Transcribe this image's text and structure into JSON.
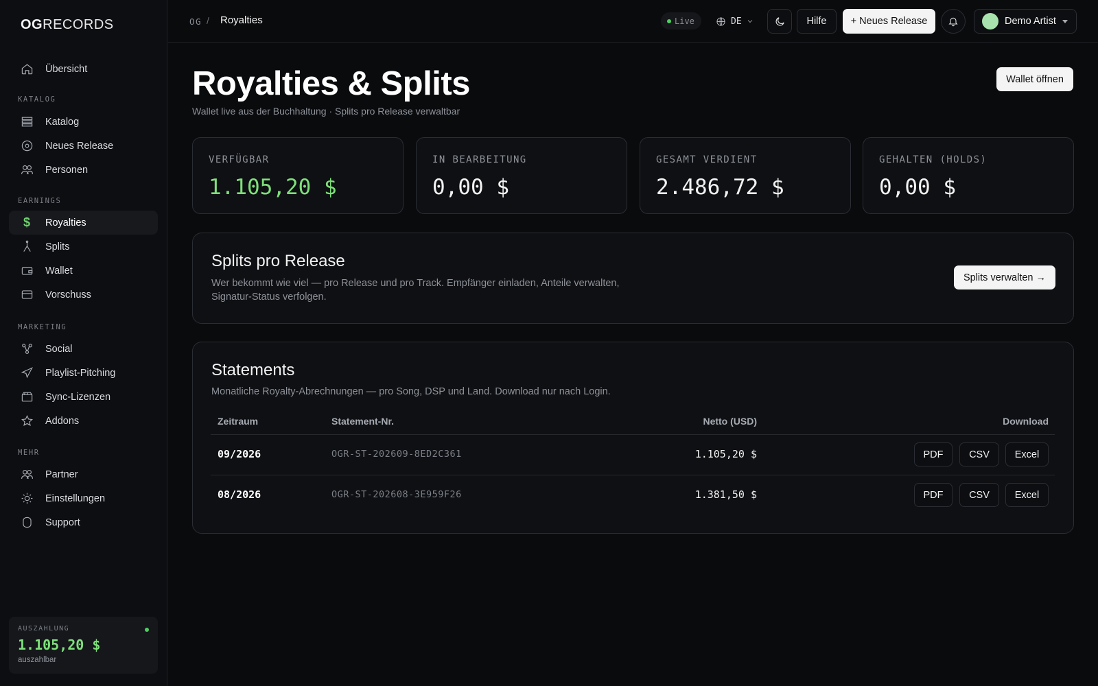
{
  "brand": {
    "logo_bold": "OG",
    "logo_rest": "RECORDS"
  },
  "sidebar": {
    "top_item": {
      "label": "Übersicht"
    },
    "sections": {
      "katalog": "KATALOG",
      "earnings": "EARNINGS",
      "marketing": "MARKETING",
      "mehr": "MEHR"
    },
    "items": {
      "katalog": "Katalog",
      "neues_release": "Neues Release",
      "personen": "Personen",
      "royalties": "Royalties",
      "splits": "Splits",
      "wallet": "Wallet",
      "vorschuss": "Vorschuss",
      "social": "Social",
      "playlist": "Playlist-Pitching",
      "sync": "Sync-Lizenzen",
      "addons": "Addons",
      "partner": "Partner",
      "einstellungen": "Einstellungen",
      "support": "Support"
    },
    "active": "Royalties",
    "payout": {
      "label": "AUSZAHLUNG",
      "amount": "1.105,20 $",
      "sub": "auszahlbar"
    }
  },
  "topbar": {
    "breadcrumb_root": "OG",
    "breadcrumb_sep": "/",
    "breadcrumb_current": "Royalties",
    "live_label": "Live",
    "language": "DE",
    "help_label": "Hilfe",
    "new_release_label": "+ Neues Release",
    "user_name": "Demo Artist"
  },
  "page": {
    "title": "Royalties & Splits",
    "subtitle": "Wallet live aus der Buchhaltung · Splits pro Release verwaltbar",
    "wallet_button": "Wallet öffnen"
  },
  "stats": [
    {
      "label": "VERFÜGBAR",
      "value": "1.105,20 $",
      "accent": true
    },
    {
      "label": "IN BEARBEITUNG",
      "value": "0,00 $",
      "accent": false
    },
    {
      "label": "GESAMT VERDIENT",
      "value": "2.486,72 $",
      "accent": false
    },
    {
      "label": "GEHALTEN (HOLDS)",
      "value": "0,00 $",
      "accent": false
    }
  ],
  "splits_card": {
    "title": "Splits pro Release",
    "desc_line1": "Wer bekommt wie viel — pro Release und pro Track. Empfänger einladen, Anteile verwalten,",
    "desc_line2": "Signatur-Status verfolgen.",
    "button": "Splits verwalten →"
  },
  "statements": {
    "title": "Statements",
    "desc": "Monatliche Royalty-Abrechnungen — pro Song, DSP und Land. Download nur nach Login.",
    "columns": [
      "Zeitraum",
      "Statement-Nr.",
      "Netto (USD)",
      "Download"
    ],
    "rows": [
      {
        "period": "09/2026",
        "id": "OGR-ST-202609-8ED2C361",
        "net": "1.105,20 $"
      },
      {
        "period": "08/2026",
        "id": "OGR-ST-202608-3E959F26",
        "net": "1.381,50 $"
      }
    ],
    "download_labels": [
      "PDF",
      "CSV",
      "Excel"
    ]
  },
  "colors": {
    "accent_green": "#7ee07a",
    "background": "#0a0b0d"
  }
}
